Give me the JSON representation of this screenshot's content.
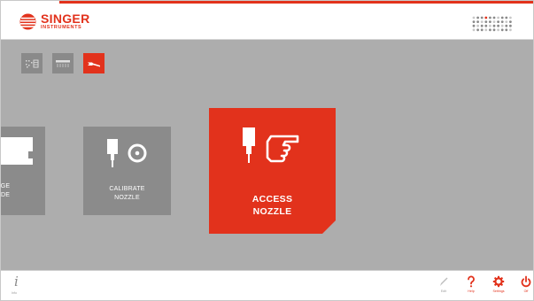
{
  "header": {
    "logo": {
      "name": "SINGER",
      "subtitle": "INSTRUMENTS"
    },
    "device_icon": "device-grid-icon"
  },
  "colors": {
    "accent": "#e2321c",
    "tile": "#8b8b8b",
    "background": "#adadad"
  },
  "modes": [
    {
      "icon": "pin-array-icon",
      "active": false
    },
    {
      "icon": "pin-row-icon",
      "active": false
    },
    {
      "icon": "wrench-icon",
      "active": true
    }
  ],
  "tiles": [
    {
      "label_line1": "GE",
      "label_line2": "DE",
      "icon": "card-slot-icon"
    },
    {
      "label_line1": "CALIBRATE",
      "label_line2": "NOZZLE",
      "icon": "nozzle-target-icon"
    },
    {
      "label_line1": "ACCESS",
      "label_line2": "NOZZLE",
      "icon": "nozzle-hand-icon",
      "selected": true
    }
  ],
  "footer": {
    "info": {
      "icon": "info-icon",
      "label": "Info"
    },
    "buttons": [
      {
        "label": "Edit",
        "icon": "pencil-icon"
      },
      {
        "label": "Help",
        "icon": "help-icon"
      },
      {
        "label": "Settings",
        "icon": "gear-icon"
      },
      {
        "label": "Off",
        "icon": "power-icon"
      }
    ]
  }
}
